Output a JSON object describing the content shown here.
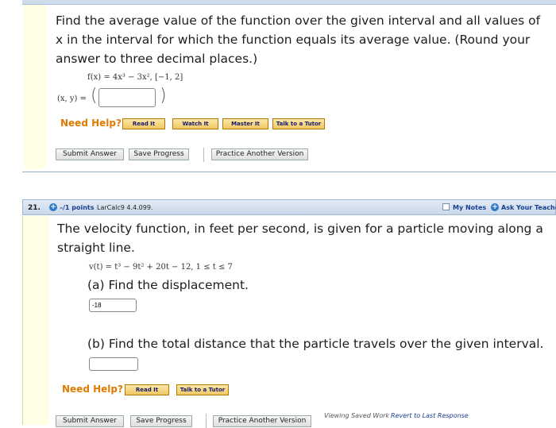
{
  "q20": {
    "prompt": "Find the average value of the function over the given interval and all values of x in the interval for which the function equals its average value. (Round your answer to three decimal places.)",
    "function_text": "f(x) = 4x³ − 3x²,   [−1, 2]",
    "point_label": "(x, y) =",
    "answer_value": "",
    "need_help": "Need Help?",
    "help_buttons": [
      "Read It",
      "Watch It",
      "Master It",
      "Talk to a Tutor"
    ],
    "submit_buttons": [
      "Submit Answer",
      "Save Progress",
      "Practice Another Version"
    ]
  },
  "q21": {
    "number": "21.",
    "points": "–/1 points",
    "course_code": "LarCalc9 4.4.099.",
    "my_notes": "My Notes",
    "ask_teacher": "Ask Your Teache",
    "prompt": "The velocity function, in feet per second, is given for a particle moving along a straight line.",
    "velocity_text": "v(t) = t³ − 9t² + 20t − 12,   1 ≤ t ≤ 7",
    "part_a": "(a) Find the displacement.",
    "answer_a": "-18",
    "part_b": "(b) Find the total distance that the particle travels over the given interval.",
    "answer_b": "",
    "need_help": "Need Help?",
    "help_buttons": [
      "Read It",
      "Talk to a Tutor"
    ],
    "submit_buttons": [
      "Submit Answer",
      "Save Progress",
      "Practice Another Version"
    ],
    "saved_note": "Viewing Saved Work",
    "revert_link": "Revert to Last Response"
  }
}
